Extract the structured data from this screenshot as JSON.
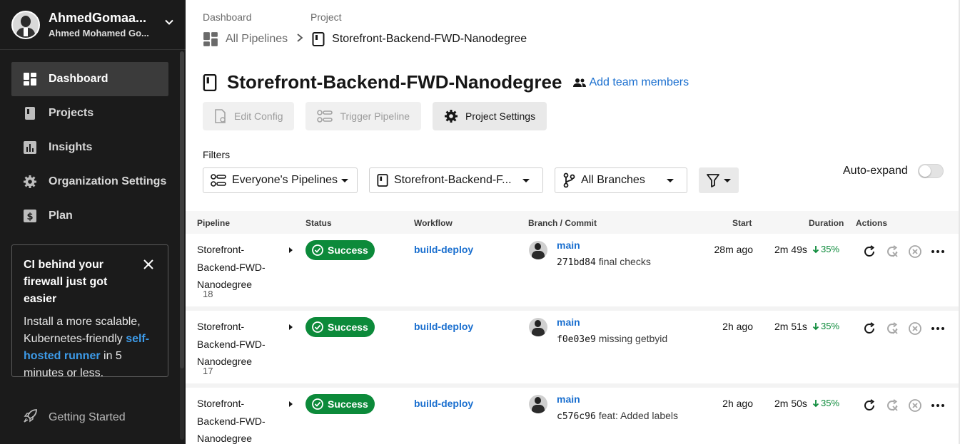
{
  "user": {
    "name": "AhmedGomaa...",
    "full_name": "Ahmed Mohamed Go..."
  },
  "nav": [
    {
      "label": "Dashboard",
      "icon": "dashboard-icon",
      "active": true
    },
    {
      "label": "Projects",
      "icon": "projects-icon"
    },
    {
      "label": "Insights",
      "icon": "insights-icon"
    },
    {
      "label": "Organization Settings",
      "icon": "gear-icon"
    },
    {
      "label": "Plan",
      "icon": "plan-icon"
    }
  ],
  "promo": {
    "title": "CI behind your firewall just got easier",
    "text_before": "Install a more scalable, Kubernetes-friendly ",
    "link": "self-hosted runner",
    "text_after": " in 5 minutes or less."
  },
  "getting_started": "Getting Started",
  "breadcrumb": {
    "label_1": "Dashboard",
    "label_2": "Project",
    "item_1": "All Pipelines",
    "item_2": "Storefront-Backend-FWD-Nanodegree"
  },
  "project": {
    "title": "Storefront-Backend-FWD-Nanodegree",
    "add_team": "Add team members"
  },
  "buttons": {
    "edit_config": "Edit Config",
    "trigger_pipeline": "Trigger Pipeline",
    "project_settings": "Project Settings"
  },
  "filters": {
    "label": "Filters",
    "pipelines": "Everyone's Pipelines",
    "project": "Storefront-Backend-F...",
    "branches": "All Branches",
    "auto_expand": "Auto-expand"
  },
  "table": {
    "headers": {
      "pipeline": "Pipeline",
      "status": "Status",
      "workflow": "Workflow",
      "branch_commit": "Branch / Commit",
      "start": "Start",
      "duration": "Duration",
      "actions": "Actions"
    },
    "rows": [
      {
        "pipeline": "Storefront-Backend-FWD-Nanodegree",
        "number": "18",
        "status": "Success",
        "workflow": "build-deploy",
        "branch": "main",
        "hash": "271bd84",
        "message": "final checks",
        "start": "28m ago",
        "duration": "2m 49s",
        "delta": "35%"
      },
      {
        "pipeline": "Storefront-Backend-FWD-Nanodegree",
        "number": "17",
        "status": "Success",
        "workflow": "build-deploy",
        "branch": "main",
        "hash": "f0e03e9",
        "message": "missing getbyid",
        "start": "2h ago",
        "duration": "2m 51s",
        "delta": "35%"
      },
      {
        "pipeline": "Storefront-Backend-FWD-Nanodegree",
        "number": "",
        "status": "Success",
        "workflow": "build-deploy",
        "branch": "main",
        "hash": "c576c96",
        "message": "feat: Added labels",
        "start": "2h ago",
        "duration": "2m 50s",
        "delta": "35%"
      }
    ]
  },
  "colors": {
    "sidebar_bg": "#1b1b1b",
    "success": "#0c8a3a",
    "link": "#1a6fcf",
    "promo_link": "#3d9be9"
  }
}
